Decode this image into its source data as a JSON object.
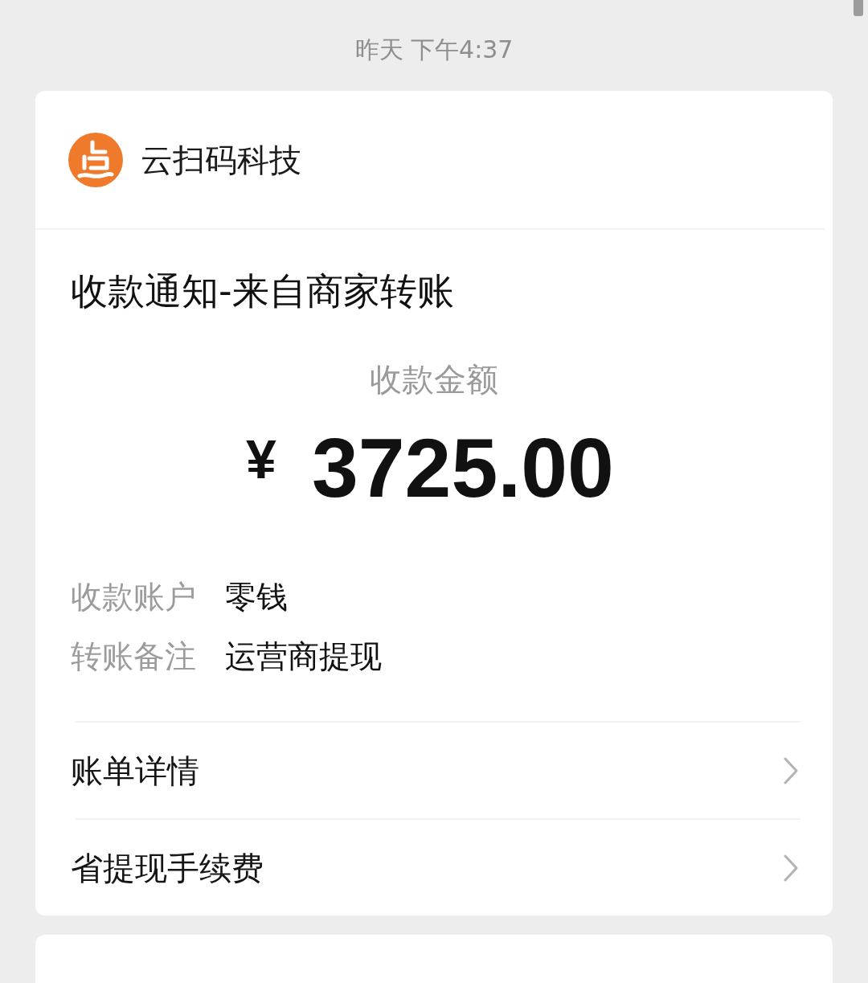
{
  "timestamp": "昨天 下午4:37",
  "merchant": {
    "name": "云扫码科技"
  },
  "notice": {
    "title": "收款通知-来自商家转账",
    "amount_label": "收款金额",
    "currency": "¥",
    "amount": "3725.00",
    "details": [
      {
        "label": "收款账户",
        "value": "零钱"
      },
      {
        "label": "转账备注",
        "value": "运营商提现"
      }
    ]
  },
  "links": [
    {
      "label": "账单详情"
    },
    {
      "label": "省提现手续费"
    }
  ]
}
